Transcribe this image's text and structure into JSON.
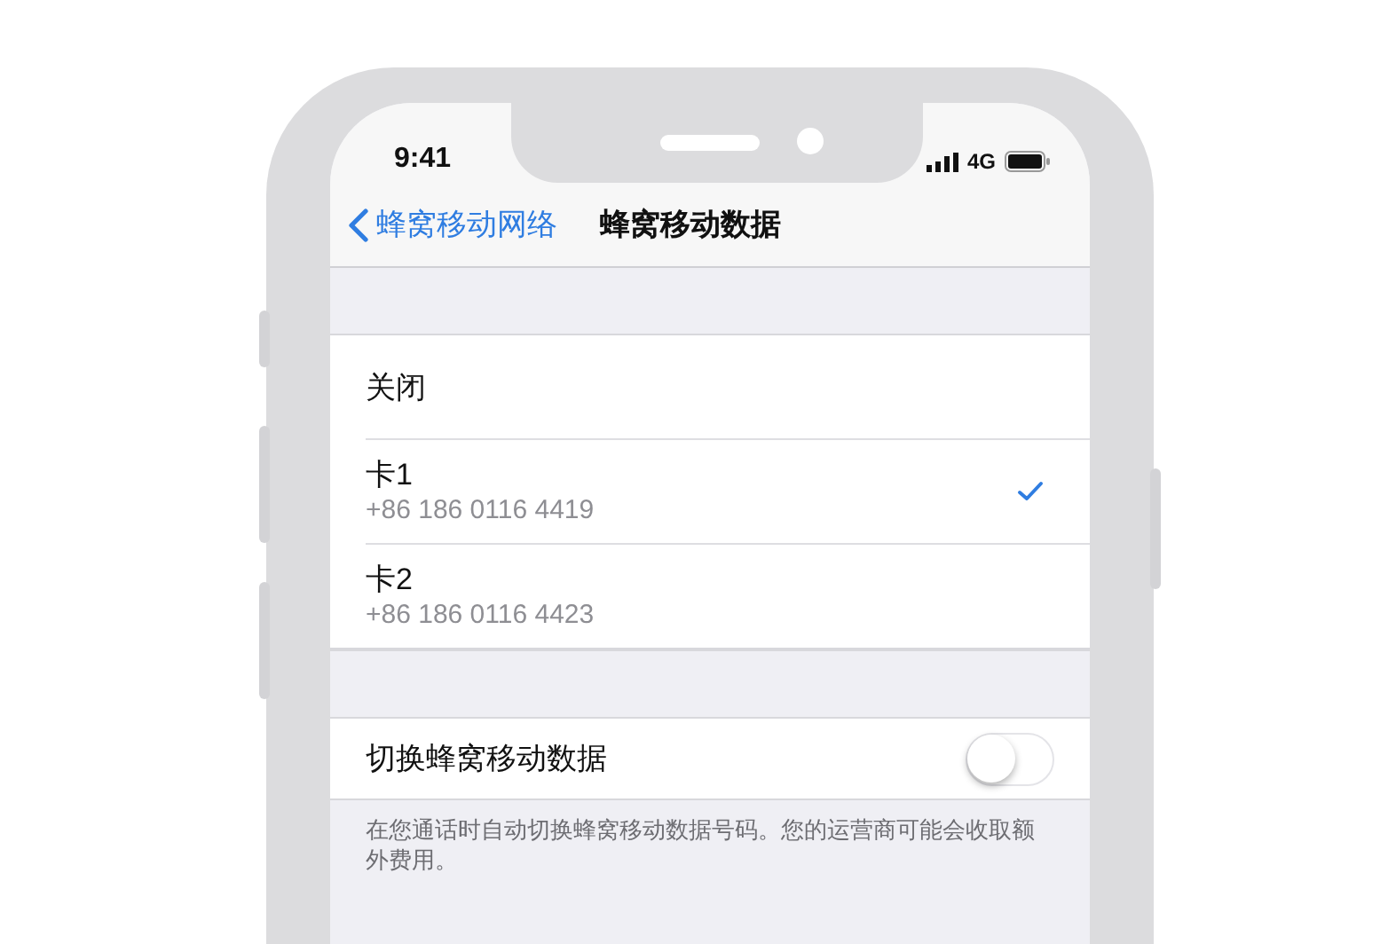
{
  "status_bar": {
    "time": "9:41",
    "network": "4G"
  },
  "nav": {
    "back": "蜂窝移动网络",
    "title": "蜂窝移动数据"
  },
  "options": [
    {
      "title": "关闭",
      "selected": false
    },
    {
      "title": "卡1",
      "subtitle": "+86 186 0116 4419",
      "selected": true
    },
    {
      "title": "卡2",
      "subtitle": "+86 186 0116 4423",
      "selected": false
    }
  ],
  "switch_row": {
    "label": "切换蜂窝移动数据",
    "on": false
  },
  "footer": "在您通话时自动切换蜂窝移动数据号码。您的运营商可能会收取额外费用。"
}
